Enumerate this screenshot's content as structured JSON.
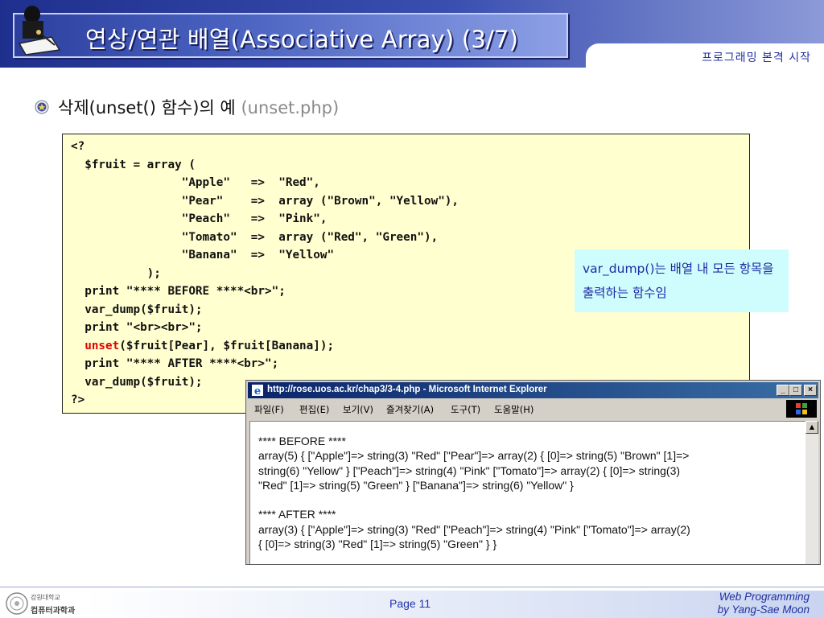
{
  "header": {
    "title": "연상/연관 배열(Associative Array) (3/7)",
    "course_label": "프로그래밍 본격 시작"
  },
  "section": {
    "heading_main": "삭제(unset() 함수)의 예",
    "heading_file": "(unset.php)"
  },
  "code": {
    "lines_before": "<?\n  $fruit = array (\n                \"Apple\"   =>  \"Red\",\n                \"Pear\"    =>  array (\"Brown\", \"Yellow\"),\n                \"Peach\"   =>  \"Pink\",\n                \"Tomato\"  =>  array (\"Red\", \"Green\"),\n                \"Banana\"  =>  \"Yellow\"\n           );\n  print \"**** BEFORE ****<br>\";\n  var_dump($fruit);\n  print \"<br><br>\";\n  ",
    "keyword": "unset",
    "lines_after": "($fruit[Pear], $fruit[Banana]);\n  print \"**** AFTER ****<br>\";\n  var_dump($fruit);\n?>"
  },
  "note": {
    "text": "var_dump()는 배열 내 모든 항목을 출력하는 함수임"
  },
  "browser": {
    "title": "http://rose.uos.ac.kr/chap3/3-4.php - Microsoft Internet Explorer",
    "menus": [
      "파일(F)",
      "편집(E)",
      "보기(V)",
      "즐겨찾기(A)",
      "도구(T)",
      "도움말(H)"
    ],
    "output_lines": [
      "**** BEFORE ****",
      "array(5) { [\"Apple\"]=> string(3) \"Red\" [\"Pear\"]=> array(2) { [0]=> string(5) \"Brown\" [1]=>",
      "string(6) \"Yellow\" } [\"Peach\"]=> string(4) \"Pink\" [\"Tomato\"]=> array(2) { [0]=> string(3)",
      "\"Red\" [1]=> string(5) \"Green\" } [\"Banana\"]=> string(6) \"Yellow\" }",
      "",
      "**** AFTER ****",
      "array(3) { [\"Apple\"]=> string(3) \"Red\" [\"Peach\"]=> string(4) \"Pink\" [\"Tomato\"]=> array(2)",
      "{ [0]=> string(3) \"Red\" [1]=> string(5) \"Green\" } }"
    ]
  },
  "footer": {
    "university": "강원대학교",
    "department": "컴퓨터과학과",
    "page": "Page 11",
    "credit_line1": "Web Programming",
    "credit_line2": "by Yang-Sae Moon"
  },
  "colors": {
    "header_blue": "#2c3f9e",
    "code_background": "#ffffd0",
    "note_background": "#cffcfc",
    "keyword_red": "#e00000"
  }
}
